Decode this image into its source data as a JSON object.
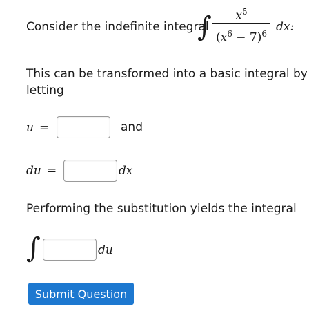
{
  "question": {
    "intro_text": "Consider the indefinite integral",
    "integrand": {
      "numerator_base": "x",
      "numerator_exp": "5",
      "denominator_open": "(",
      "denominator_base": "x",
      "denominator_inner_exp": "6",
      "denominator_rest": " − 7)",
      "denominator_exp": "6",
      "differential": "dx:"
    },
    "transform_text_line1": "This can be transformed into a basic integral by",
    "transform_text_line2": "letting",
    "u_label": "u",
    "equals": "=",
    "and_text": "and",
    "du_label": "du",
    "dx_text": "dx",
    "substitution_text": "Performing the substitution yields the integral",
    "du_suffix": "du",
    "integral_sign": "∫"
  },
  "inputs": {
    "u_value": "",
    "du_value": "",
    "integral_value": ""
  },
  "actions": {
    "submit_label": "Submit Question"
  },
  "colors": {
    "submit_background": "#1d78d0",
    "submit_text": "#ffffff",
    "input_border": "#9a9a9a"
  }
}
